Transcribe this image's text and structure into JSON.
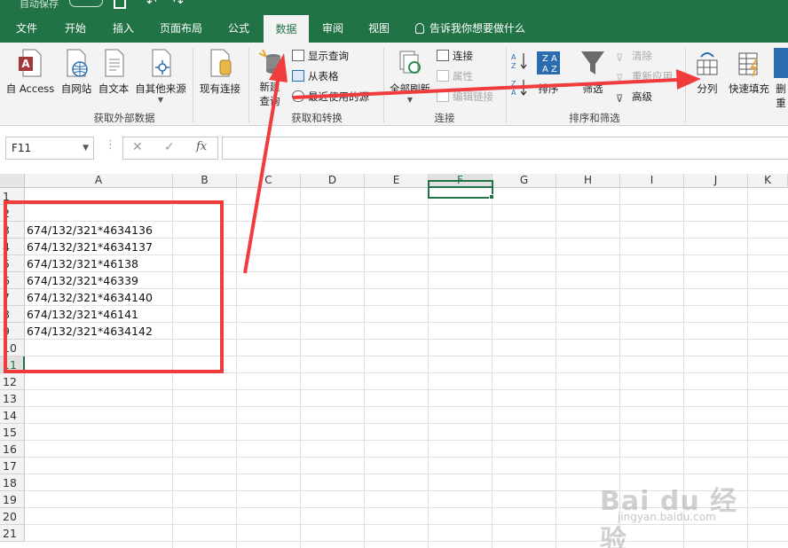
{
  "titlebar": {
    "autosave": "自动保存"
  },
  "tabs": [
    "文件",
    "开始",
    "插入",
    "页面布局",
    "公式",
    "数据",
    "审阅",
    "视图"
  ],
  "active_tab": "数据",
  "tell_me": "告诉我你想要做什么",
  "ribbon": {
    "external_data": {
      "access": "自 Access",
      "web": "自网站",
      "text": "自文本",
      "other": "自其他来源",
      "existing": "现有连接",
      "group_label": "获取外部数据"
    },
    "transform": {
      "new_query_line1": "新建",
      "new_query_line2": "查询",
      "show_queries": "显示查询",
      "from_table": "从表格",
      "recent_sources": "最近使用的源",
      "group_label": "获取和转换"
    },
    "connections": {
      "refresh_all": "全部刷新",
      "connections": "连接",
      "properties": "属性",
      "edit_links": "编辑链接",
      "group_label": "连接"
    },
    "sort_filter": {
      "sort": "排序",
      "filter": "筛选",
      "clear": "清除",
      "reapply": "重新应用",
      "advanced": "高级",
      "group_label": "排序和筛选"
    },
    "data_tools": {
      "text_to_columns": "分列",
      "flash_fill": "快速填充",
      "remove_dup_line1": "删",
      "remove_dup_line2": "重"
    }
  },
  "formula_bar": {
    "name_box": "F11",
    "fx": "fx",
    "dots": "⋮",
    "formula": ""
  },
  "columns": [
    "A",
    "B",
    "C",
    "D",
    "E",
    "F",
    "G",
    "H",
    "I",
    "J",
    "K"
  ],
  "selected_column": "F",
  "rows": [
    "1",
    "2",
    "3",
    "4",
    "5",
    "6",
    "7",
    "8",
    "9",
    "10",
    "11",
    "12",
    "13",
    "14",
    "15",
    "16",
    "17",
    "18",
    "19",
    "20",
    "21"
  ],
  "selected_row": "11",
  "cells_A": [
    "",
    "",
    "674/132/321*4634136",
    "674/132/321*4634137",
    "674/132/321*46138",
    "674/132/321*46339",
    "674/132/321*4634140",
    "674/132/321*46141",
    "674/132/321*4634142",
    "",
    ""
  ],
  "watermark": {
    "main": "Bai du 经验",
    "sub": "jingyan.baidu.com"
  },
  "colors": {
    "excel_green": "#217346",
    "annotation_red": "#f03c3c"
  }
}
